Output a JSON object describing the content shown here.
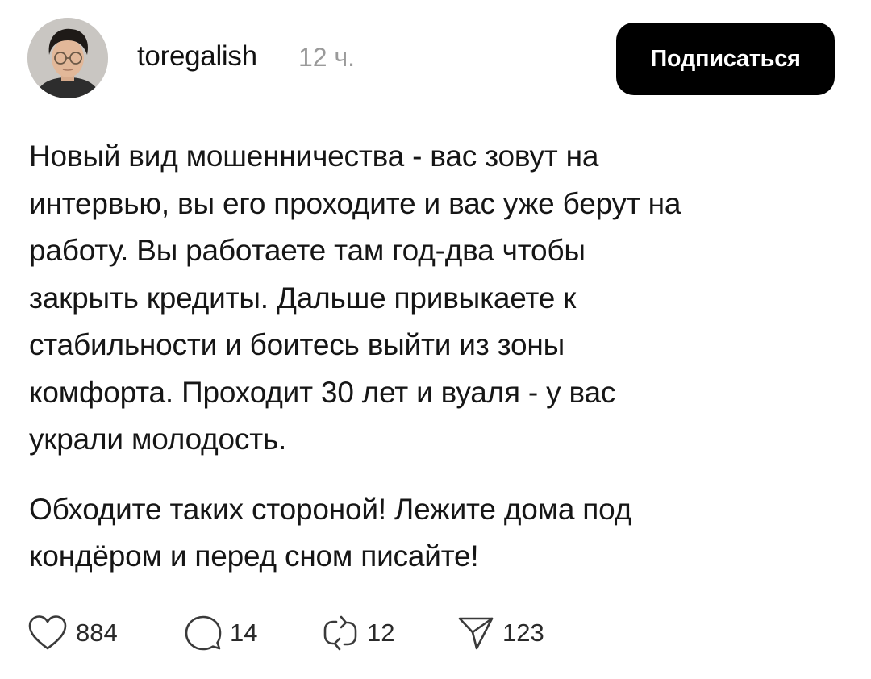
{
  "post": {
    "author": {
      "username": "toregalish",
      "avatar_alt": "user avatar"
    },
    "time_ago": "12 ч.",
    "follow_label": "Подписаться",
    "paragraphs": [
      [
        "Новый вид мошенничества - вас зовут на",
        "интервью, вы его проходите и вас уже берут на",
        "работу. Вы работаете там год-два чтобы",
        "закрыть кредиты. Дальше привыкаете к",
        "стабильности и боитесь выйти из зоны",
        "комфорта. Проходит 30 лет и вуаля - у вас",
        "украли молодость."
      ],
      [
        "Обходите таких стороной! Лежите дома под",
        "кондёром и перед сном писайте!"
      ]
    ],
    "actions": {
      "likes": "884",
      "comments": "14",
      "reposts": "12",
      "shares": "123"
    }
  },
  "icons": {
    "like": "heart-icon",
    "comment": "speech-bubble-icon",
    "repost": "repost-arrows-icon",
    "share": "paper-plane-icon"
  },
  "colors": {
    "follow_button_bg": "#000000",
    "follow_button_text": "#ffffff",
    "timestamp": "#9a9a9a",
    "text": "#161616"
  }
}
